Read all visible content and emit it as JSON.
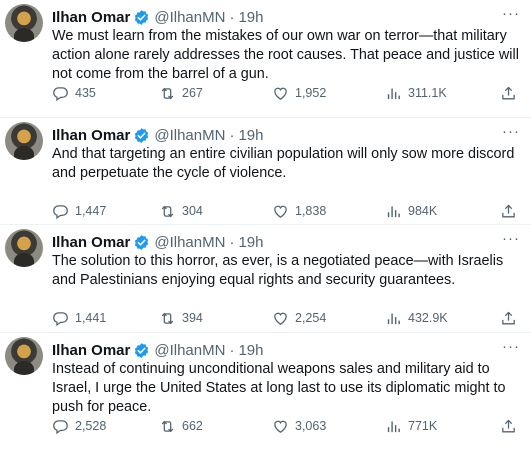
{
  "colors": {
    "text": "#0f1419",
    "secondary": "#536471",
    "verified": "#1d9bf0",
    "divider": "#eff3f4"
  },
  "tweets": [
    {
      "name": "Ilhan Omar",
      "handle": "@IlhanMN",
      "separator": "·",
      "time": "19h",
      "text": "We must learn from the mistakes of our own war on terror—that military action alone rarely addresses the root causes. That peace and justice will not come from the barrel of a gun.",
      "replies": "435",
      "reposts": "267",
      "likes": "1,952",
      "views": "311.1K"
    },
    {
      "name": "Ilhan Omar",
      "handle": "@IlhanMN",
      "separator": "·",
      "time": "19h",
      "text": "And that targeting an entire civilian population will only sow more discord and perpetuate the cycle of violence.",
      "replies": "1,447",
      "reposts": "304",
      "likes": "1,838",
      "views": "984K"
    },
    {
      "name": "Ilhan Omar",
      "handle": "@IlhanMN",
      "separator": "·",
      "time": "19h",
      "text": "The solution to this horror, as ever, is a negotiated peace—with Israelis and Palestinians enjoying equal rights and security guarantees.",
      "replies": "1,441",
      "reposts": "394",
      "likes": "2,254",
      "views": "432.9K"
    },
    {
      "name": "Ilhan Omar",
      "handle": "@IlhanMN",
      "separator": "·",
      "time": "19h",
      "text": "Instead of continuing unconditional weapons sales and military aid to Israel, I urge the United States at long last to use its diplomatic might to push for peace.",
      "replies": "2,528",
      "reposts": "662",
      "likes": "3,063",
      "views": "771K"
    }
  ]
}
